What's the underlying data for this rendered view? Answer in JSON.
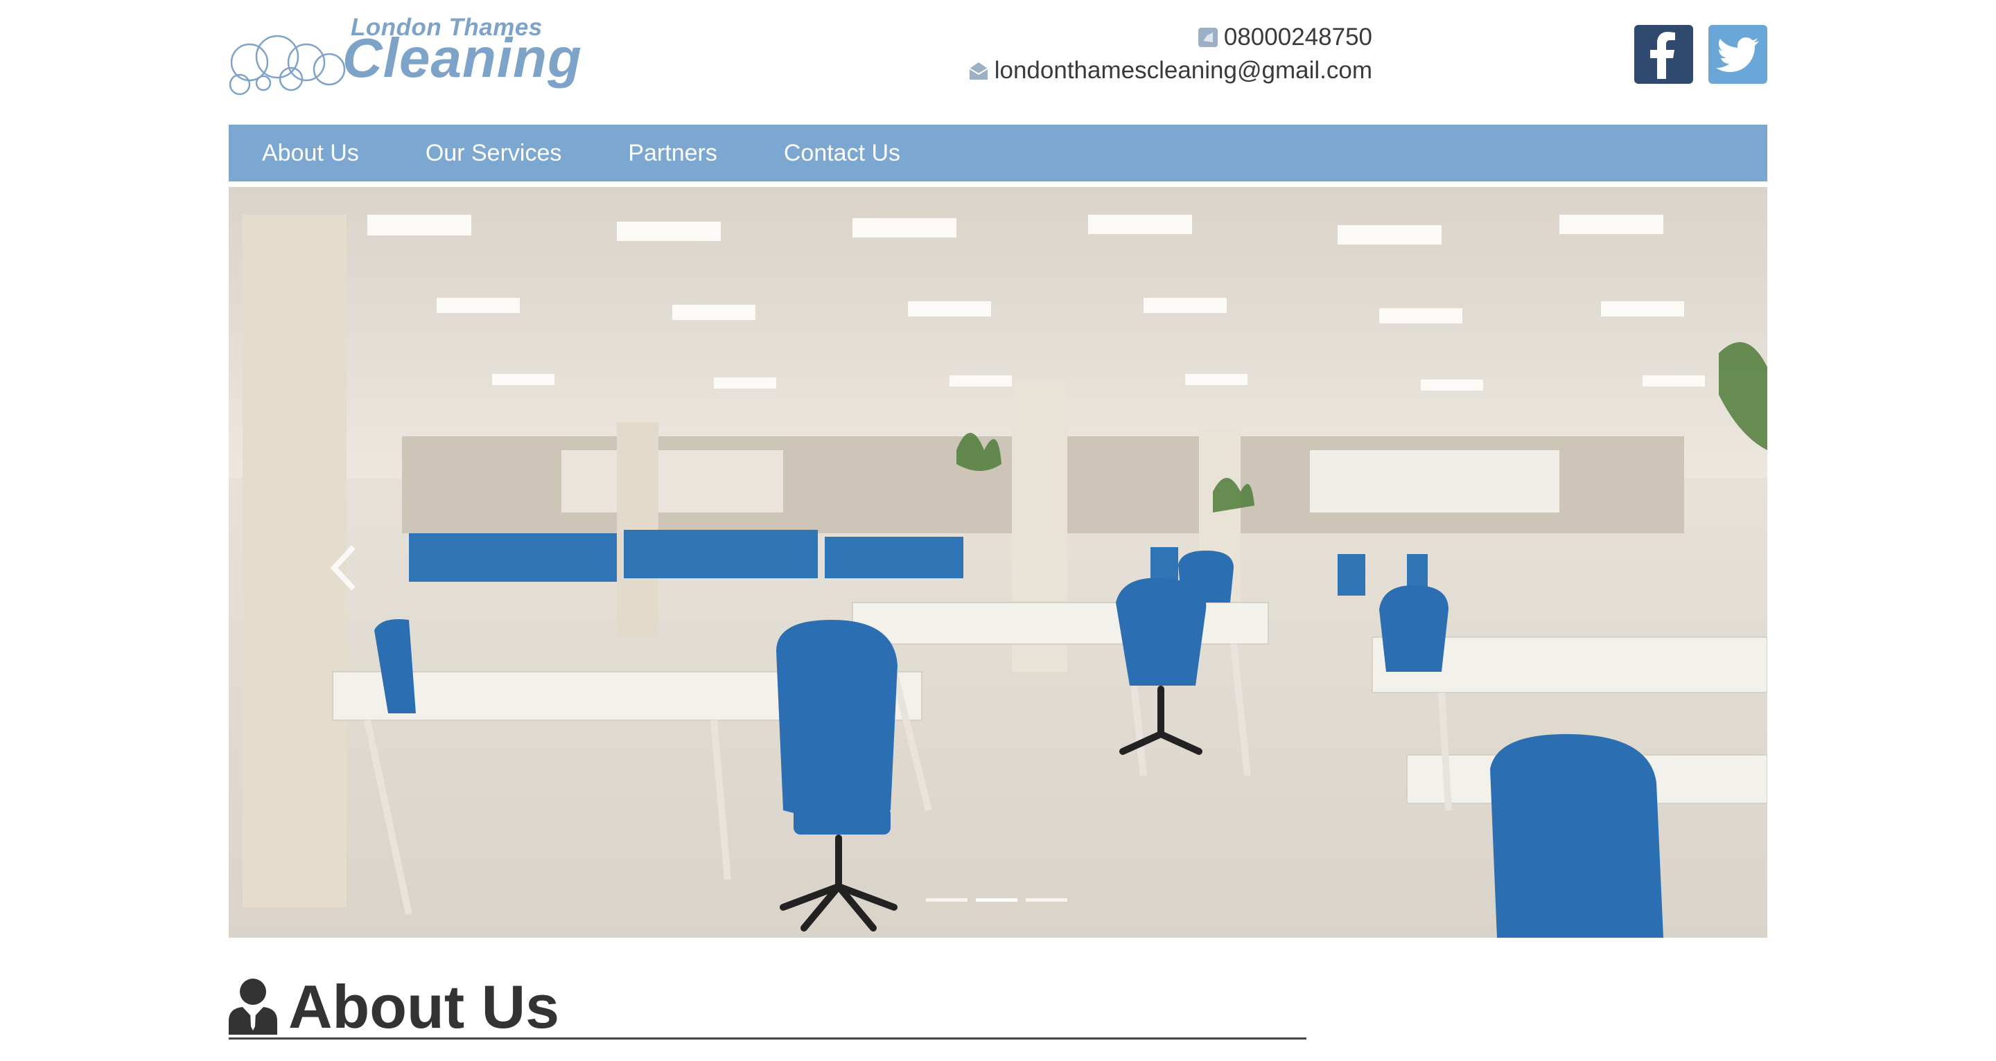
{
  "brand": {
    "logo_top": "London Thames",
    "logo_main": "Cleaning"
  },
  "contact": {
    "phone": "08000248750",
    "email": "londonthamescleaning@gmail.com"
  },
  "social": {
    "facebook_icon": "facebook-icon",
    "twitter_icon": "twitter-icon"
  },
  "nav": {
    "items": [
      {
        "label": "About Us"
      },
      {
        "label": "Our Services"
      },
      {
        "label": "Partners"
      },
      {
        "label": "Contact Us"
      }
    ]
  },
  "hero": {
    "image_desc": "office-photo",
    "indicators": 3,
    "active_indicator": 2
  },
  "about": {
    "title": "About Us",
    "icon": "person-icon"
  },
  "colors": {
    "brand_blue": "#7ba7d1",
    "text": "#333333"
  }
}
